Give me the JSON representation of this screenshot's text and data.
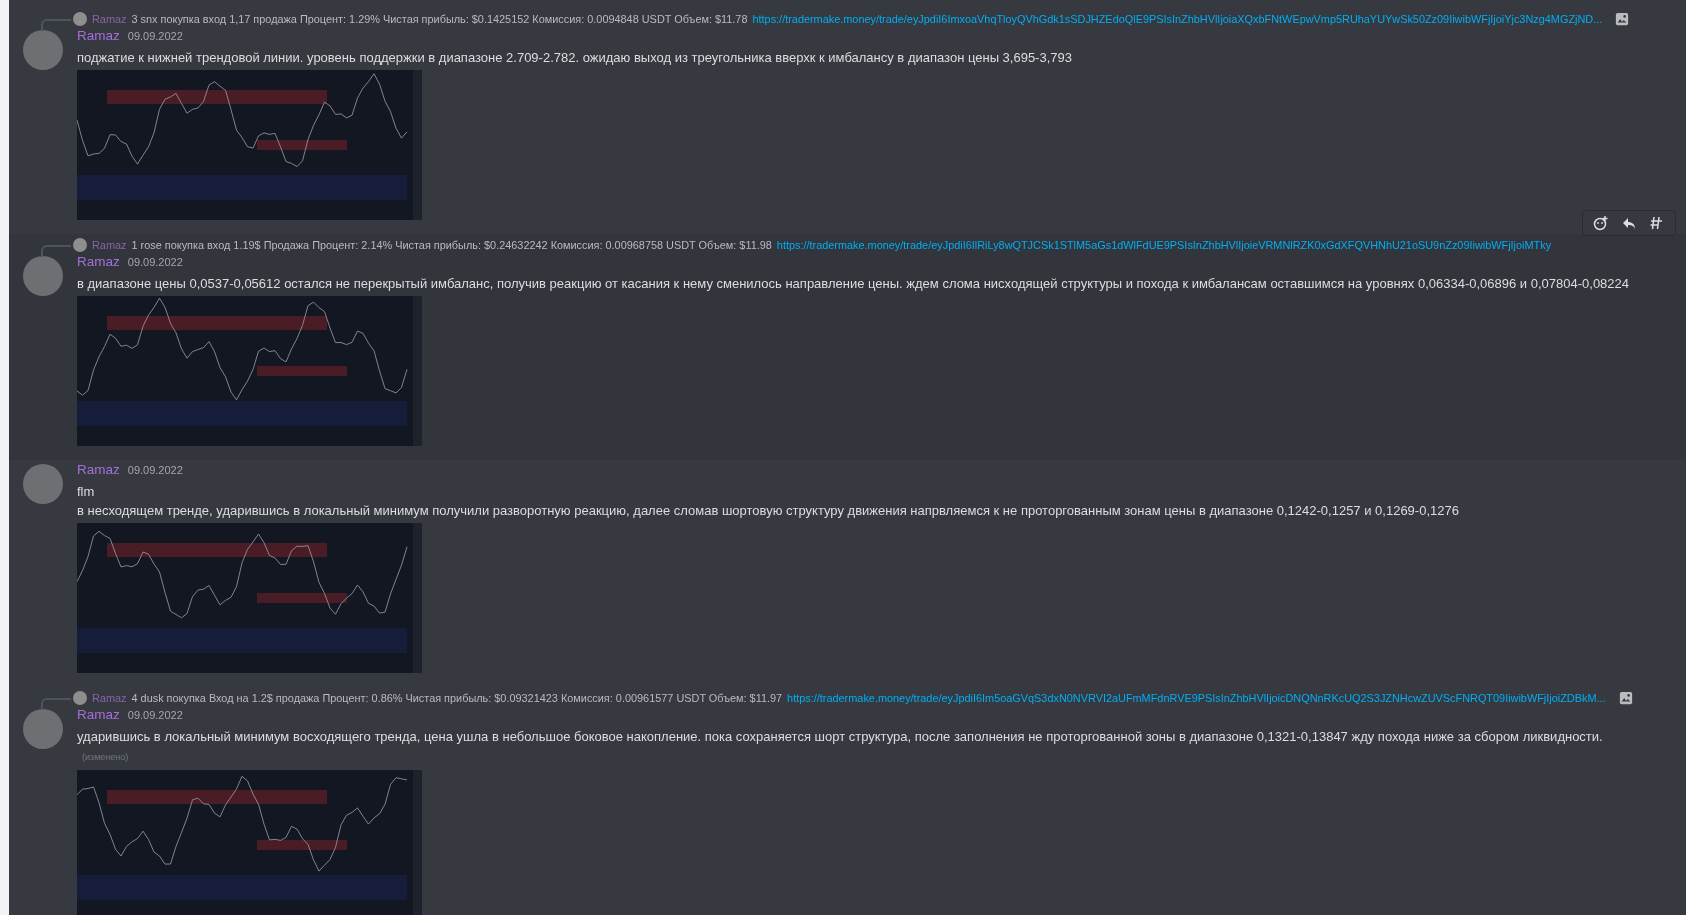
{
  "messages": [
    {
      "reply": {
        "author": "Ramaz",
        "text": "3 snx покупка  вход 1,17  продажа  Процент: 1.29% Чистая прибыль: $0.1425152 Комиссия: 0.0094848 USDT Объем: $11.78",
        "link": "https://tradermake.money/trade/eyJpdiI6ImxoaVhqTloyQVhGdk1sSDJHZEdoQlE9PSIsInZhbHVlIjoiaXQxbFNtWEpwVmp5RUhaYUYwSk50Zz09IiwibWFjIjoiYjc3Nzg4MGZjND...",
        "attachment_icon": true
      },
      "author": "Ramaz",
      "date": "09.09.2022",
      "lines": [
        "поджатие к нижней трендовой линии. уровень поддержки в диапазоне 2.709-2.782. ожидаю выход из треугольника вверхк к имбалансу в диапазон цены 3,695-3,793"
      ],
      "hovered": false
    },
    {
      "reply": {
        "author": "Ramaz",
        "text": "1 rose покупка  вход 1.19$  Продажа   Процент: 2.14% Чистая прибыль: $0.24632242 Комиссия: 0.00968758 USDT Объем: $11.98",
        "link": "https://tradermake.money/trade/eyJpdiI6IlRiLy8wQTJCSk1STlM5aGs1dWlFdUE9PSIsInZhbHVlIjoieVRMNlRZK0xGdXFQVHNhU21oSU9nZz09IiwibWFjIjoiMTky",
        "attachment_icon": false
      },
      "author": "Ramaz",
      "date": "09.09.2022",
      "lines": [
        "в диапазоне цены 0,0537-0,05612 остался не перекрытый имбаланс, получив реакцию от касания к нему сменилось направление цены. ждем слома нисходящей структуры и похода к имбалансам оставшимся на уровнях 0,06334-0,06896 и 0,07804-0,08224"
      ],
      "hovered": true
    },
    {
      "author": "Ramaz",
      "date": "09.09.2022",
      "lines": [
        "flm",
        "в несходящем тренде, ударившись в локальный минимум получили разворотную реакцию, далее сломав шортовую структуру движения напрвляемся к не проторгованным зонам цены в диапазоне 0,1242-0,1257 и 0,1269-0,1276"
      ],
      "hovered": false
    },
    {
      "reply": {
        "author": "Ramaz",
        "text": "4 dusk  покупка Вход на 1.2$  продажа  Процент: 0.86% Чистая прибыль: $0.09321423 Комиссия: 0.00961577 USDT Объем: $11.97",
        "link": "https://tradermake.money/trade/eyJpdiI6Im5oaGVqS3dxN0NVRVI2aUFmMFdnRVE9PSIsInZhbHVlIjoicDNQNnRKcUQ2S3JZNHcwZUVScFNRQT09IiwibWFjIjoiZDBkM...",
        "attachment_icon": true
      },
      "author": "Ramaz",
      "date": "09.09.2022",
      "lines": [
        "ударившись в локальный минимум восходящего тренда, цена ушла в небольшое боковое накопление. пока сохраняется шорт структура, после заполнения не проторгованной зоны в диапазоне 0,1321-0,13847 жду похода ниже за сбором ликвидности."
      ],
      "edited": "(изменено)",
      "hovered": false
    }
  ]
}
